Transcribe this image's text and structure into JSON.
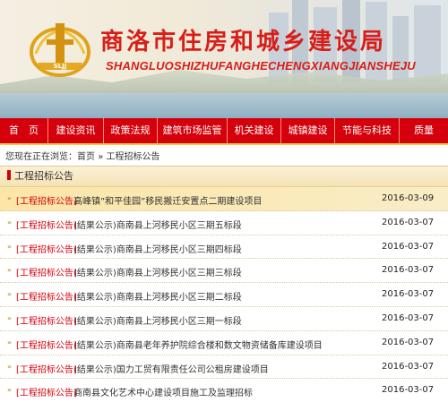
{
  "header": {
    "title_cn": "商洛市住房和城乡建设局",
    "title_en": "SHANGLUOSHIZHUFANGHECHENGXIANGJIANSHEJU"
  },
  "nav": {
    "items": [
      "首　页",
      "建设资讯",
      "政策法规",
      "建筑市场监管",
      "机关建设",
      "城镇建设",
      "节能与科技",
      "质量"
    ]
  },
  "breadcrumb": {
    "prefix": "您现在正在浏览：",
    "home": "首页",
    "sep": "»",
    "current": "工程招标公告"
  },
  "panel": {
    "title": "工程招标公告"
  },
  "list": [
    {
      "cat": "[工程招标公告]",
      "text": "高峰镇”和平佳园”移民搬迁安置点二期建设项目",
      "date": "2016-03-09"
    },
    {
      "cat": "[工程招标公告]",
      "text": "(结果公示)商南县上河移民小区三期五标段",
      "date": "2016-03-07"
    },
    {
      "cat": "[工程招标公告]",
      "text": "(结果公示)商南县上河移民小区三期四标段",
      "date": "2016-03-07"
    },
    {
      "cat": "[工程招标公告]",
      "text": "(结果公示)商南县上河移民小区三期三标段",
      "date": "2016-03-07"
    },
    {
      "cat": "[工程招标公告]",
      "text": "(结果公示)商南县上河移民小区三期二标段",
      "date": "2016-03-07"
    },
    {
      "cat": "[工程招标公告]",
      "text": "(结果公示)商南县上河移民小区三期一标段",
      "date": "2016-03-07"
    },
    {
      "cat": "[工程招标公告]",
      "text": "(结果公示)商南县老年养护院综合楼和数文物资储备库建设项目",
      "date": "2016-03-07"
    },
    {
      "cat": "[工程招标公告]",
      "text": "(结果公示)国力工贸有限责任公司公租房建设项目",
      "date": "2016-03-07"
    },
    {
      "cat": "[工程招标公告]",
      "text": "商南县文化艺术中心建设项目施工及监理招标",
      "date": "2016-03-07"
    }
  ],
  "colors": {
    "accent": "#d4000b",
    "highlight_row": "#fbe6a8",
    "gold_rule": "#f3c44a"
  },
  "icons": {
    "logo": "emblem-logo-icon",
    "bullet": "double-chevron-icon"
  }
}
